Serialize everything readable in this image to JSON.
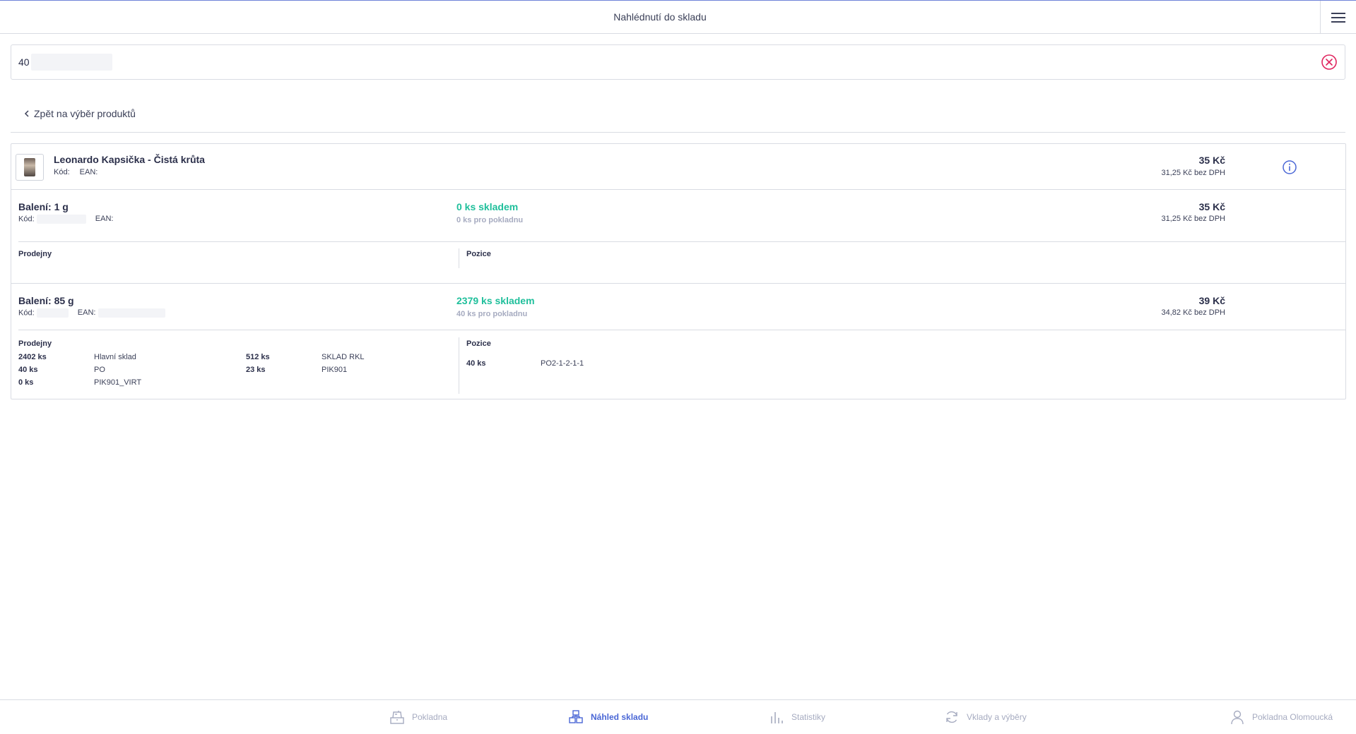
{
  "header": {
    "title": "Nahlédnutí do skladu"
  },
  "search": {
    "value": "40"
  },
  "back": {
    "label": "Zpět na výběr produktů"
  },
  "product": {
    "name": "Leonardo Kapsička - Čistá krůta",
    "code_label": "Kód:",
    "ean_label": "EAN:",
    "price": "35 Kč",
    "price_net": "31,25 Kč bez DPH"
  },
  "packages": [
    {
      "title": "Balení: 1 g",
      "code_label": "Kód:",
      "ean_label": "EAN:",
      "stock": "0 ks skladem",
      "stock_pos": "0 ks pro pokladnu",
      "price": "35 Kč",
      "price_net": "31,25 Kč bez DPH",
      "stores_label": "Prodejny",
      "positions_label": "Pozice"
    },
    {
      "title": "Balení: 85 g",
      "code_label": "Kód:",
      "ean_label": "EAN:",
      "stock": "2379 ks skladem",
      "stock_pos": "40 ks pro pokladnu",
      "price": "39 Kč",
      "price_net": "34,82 Kč bez DPH",
      "stores_label": "Prodejny",
      "positions_label": "Pozice",
      "stores": [
        {
          "qty": "2402 ks",
          "name": "Hlavní sklad"
        },
        {
          "qty": "512 ks",
          "name": "SKLAD RKL"
        },
        {
          "qty": "40 ks",
          "name": "PO"
        },
        {
          "qty": "23 ks",
          "name": "PIK901"
        },
        {
          "qty": "0 ks",
          "name": "PIK901_VIRT"
        }
      ],
      "positions": [
        {
          "qty": "40 ks",
          "name": "PO2-1-2-1-1"
        }
      ]
    }
  ],
  "nav": [
    {
      "label": "Pokladna",
      "icon": "cash-register-icon"
    },
    {
      "label": "Náhled skladu",
      "icon": "warehouse-boxes-icon"
    },
    {
      "label": "Statistiky",
      "icon": "bar-chart-icon"
    },
    {
      "label": "Vklady a výběry",
      "icon": "refresh-icon"
    },
    {
      "label": "Pokladna Olomoucká",
      "icon": "user-icon"
    }
  ],
  "colors": {
    "accent": "#4a67d6",
    "stock": "#1fbf9b",
    "clear": "#e0245e"
  }
}
